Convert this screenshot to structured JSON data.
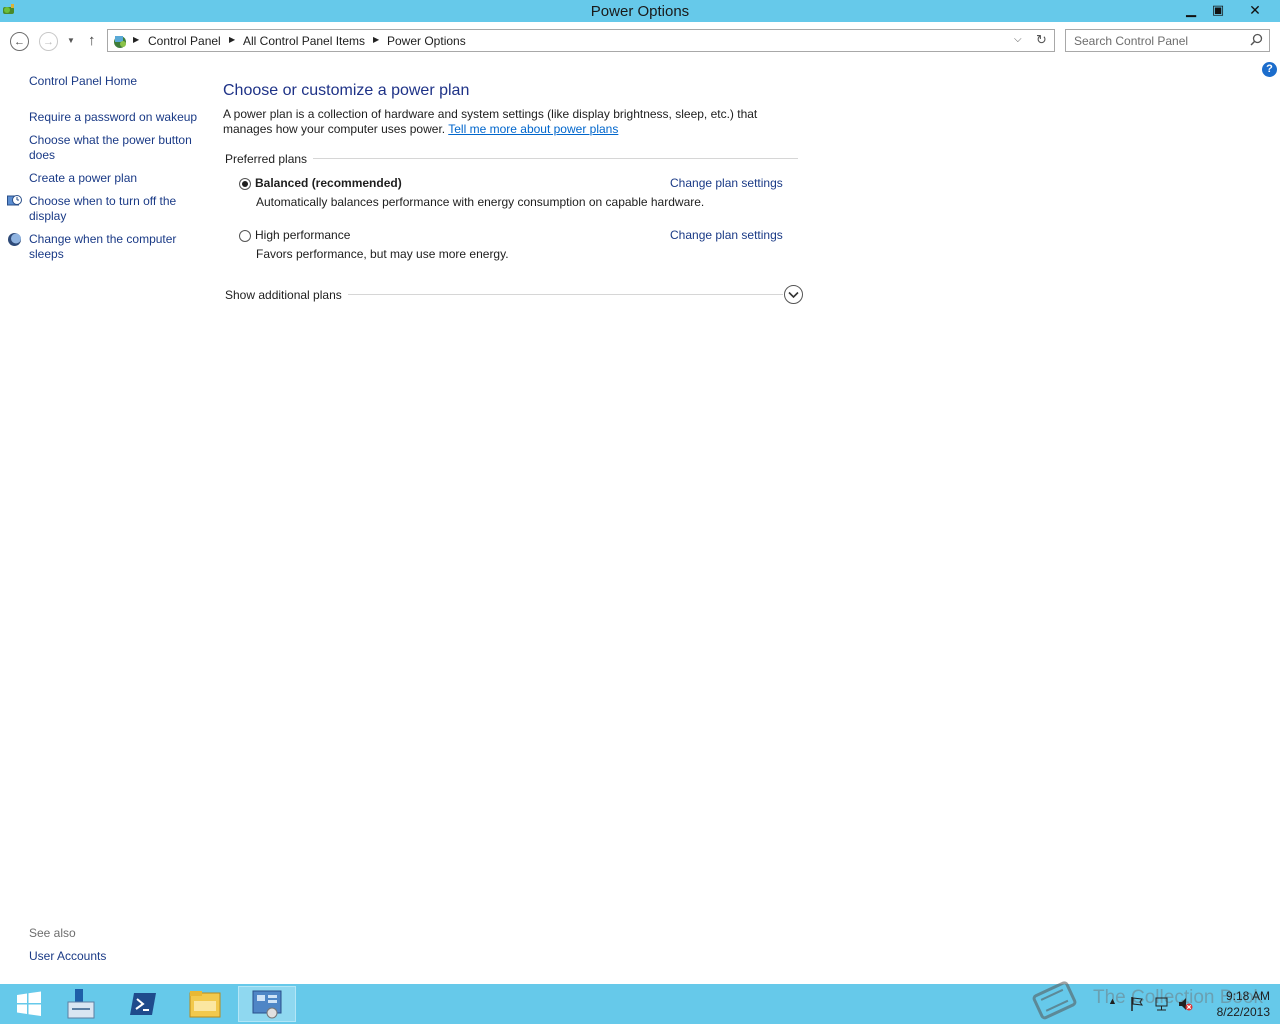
{
  "window": {
    "title": "Power Options",
    "minimize_glyph": "▁",
    "maximize_glyph": "▣",
    "close_glyph": "✕"
  },
  "nav": {
    "back_glyph": "←",
    "forward_glyph": "→",
    "recent_glyph": "▼",
    "up_glyph": "↑",
    "breadcrumb": [
      "Control Panel",
      "All Control Panel Items",
      "Power Options"
    ],
    "dropdown_glyph": "⌵",
    "refresh_glyph": "↻"
  },
  "search": {
    "placeholder": "Search Control Panel"
  },
  "help": {
    "glyph": "?"
  },
  "sidebar": {
    "items": [
      {
        "label": "Control Panel Home",
        "icon": ""
      },
      {
        "label": "Require a password on wakeup",
        "icon": ""
      },
      {
        "label": "Choose what the power button does",
        "icon": ""
      },
      {
        "label": "Create a power plan",
        "icon": ""
      },
      {
        "label": "Choose when to turn off the display",
        "icon": "display-clock-icon"
      },
      {
        "label": "Change when the computer sleeps",
        "icon": "moon-icon"
      }
    ],
    "see_also_label": "See also",
    "see_also_items": [
      "User Accounts"
    ]
  },
  "main": {
    "heading": "Choose or customize a power plan",
    "description": "A power plan is a collection of hardware and system settings (like display brightness, sleep, etc.) that manages how your computer uses power.",
    "description_link": "Tell me more about power plans",
    "group_label": "Preferred plans",
    "plans": [
      {
        "name": "Balanced (recommended)",
        "description": "Automatically balances performance with energy consumption on capable hardware.",
        "selected": true,
        "link": "Change plan settings"
      },
      {
        "name": "High performance",
        "description": "Favors performance, but may use more energy.",
        "selected": false,
        "link": "Change plan settings"
      }
    ],
    "show_additional": "Show additional plans"
  },
  "taskbar": {
    "items": [
      "start-icon",
      "server-manager-icon",
      "powershell-icon",
      "file-explorer-icon",
      "control-panel-icon"
    ],
    "active_index": 4,
    "tray_up_glyph": "▲",
    "time": "9:18 AM",
    "date": "8/22/2013",
    "watermark": "The Collection Book"
  },
  "colors": {
    "chrome": "#66c9ea",
    "link": "#1a3a86",
    "heading": "#1e3287",
    "underline_link": "#0066cc"
  }
}
